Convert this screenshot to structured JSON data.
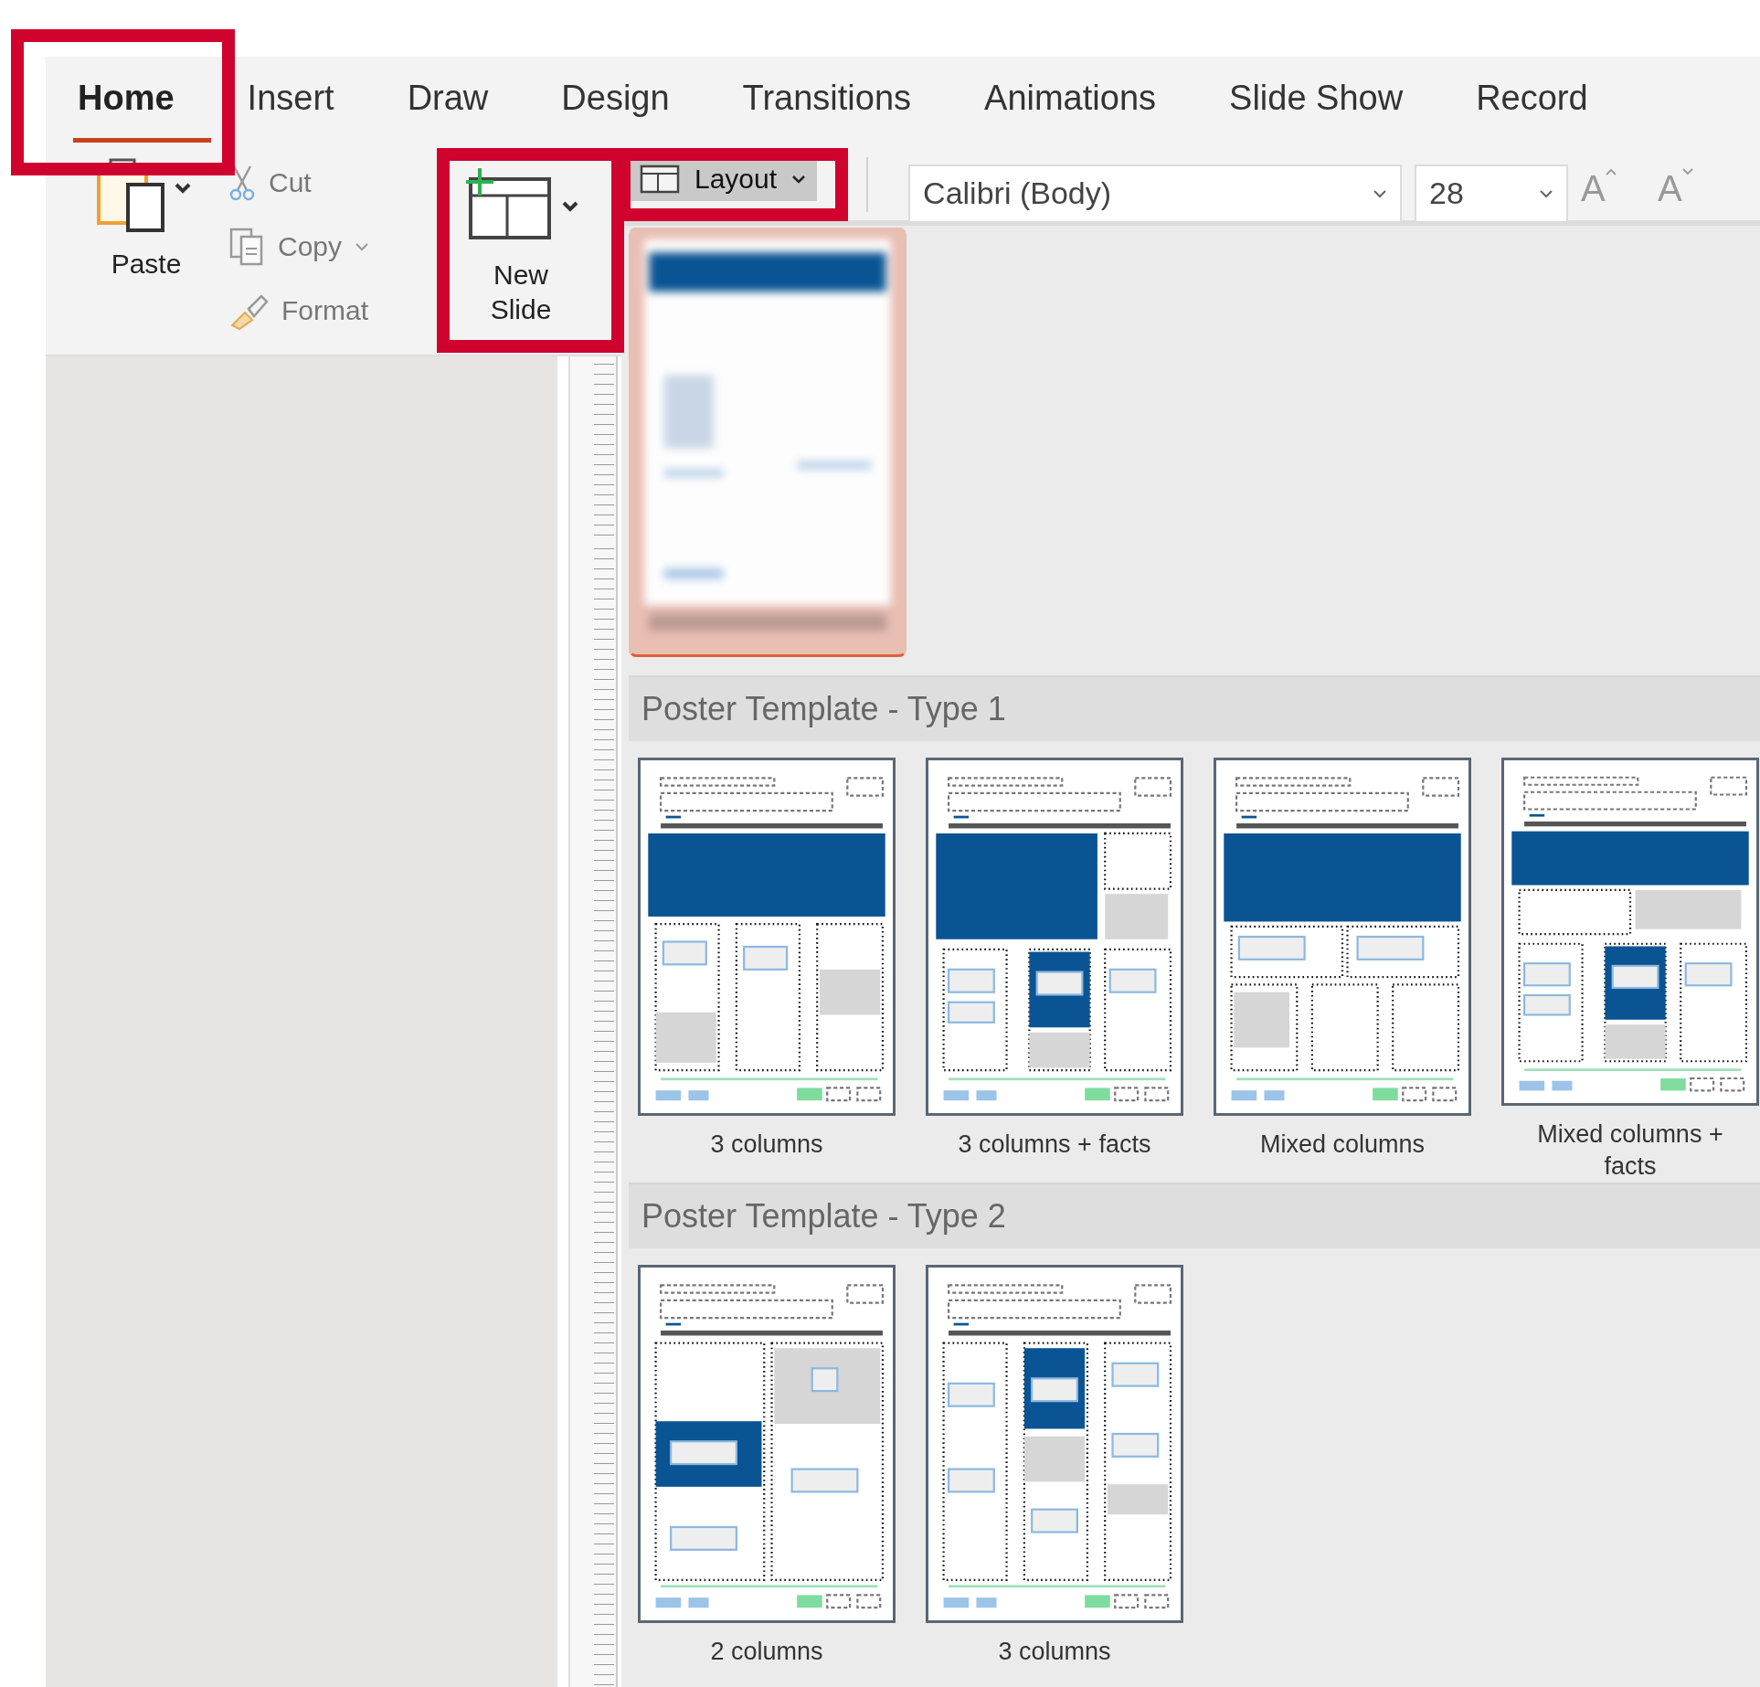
{
  "tabs": [
    {
      "label": "Home",
      "selected": true
    },
    {
      "label": "Insert",
      "selected": false
    },
    {
      "label": "Draw",
      "selected": false
    },
    {
      "label": "Design",
      "selected": false
    },
    {
      "label": "Transitions",
      "selected": false
    },
    {
      "label": "Animations",
      "selected": false
    },
    {
      "label": "Slide Show",
      "selected": false
    },
    {
      "label": "Record",
      "selected": false
    }
  ],
  "clipboard": {
    "paste": "Paste",
    "cut": "Cut",
    "copy": "Copy",
    "format": "Format"
  },
  "slides": {
    "new_slide": "New Slide",
    "layout": "Layout"
  },
  "font": {
    "family": "Calibri (Body)",
    "size": "28",
    "grow": "A",
    "shrink": "A"
  },
  "layout_gallery": {
    "current": {
      "selected": true
    },
    "sections": [
      {
        "title": "Poster Template - Type 1",
        "layouts": [
          {
            "name": "3 columns",
            "kind": "three-col",
            "selected": false
          },
          {
            "name": "3 columns + facts",
            "kind": "three-col-facts",
            "selected": false
          },
          {
            "name": "Mixed columns",
            "kind": "mixed",
            "selected": false
          },
          {
            "name": "Mixed columns + facts",
            "kind": "mixed-facts",
            "selected": false
          }
        ]
      },
      {
        "title": "Poster Template - Type 2",
        "layouts": [
          {
            "name": "2 columns",
            "kind": "two-col",
            "selected": false
          },
          {
            "name": "3 columns",
            "kind": "three-col-b",
            "selected": false
          }
        ]
      }
    ]
  }
}
